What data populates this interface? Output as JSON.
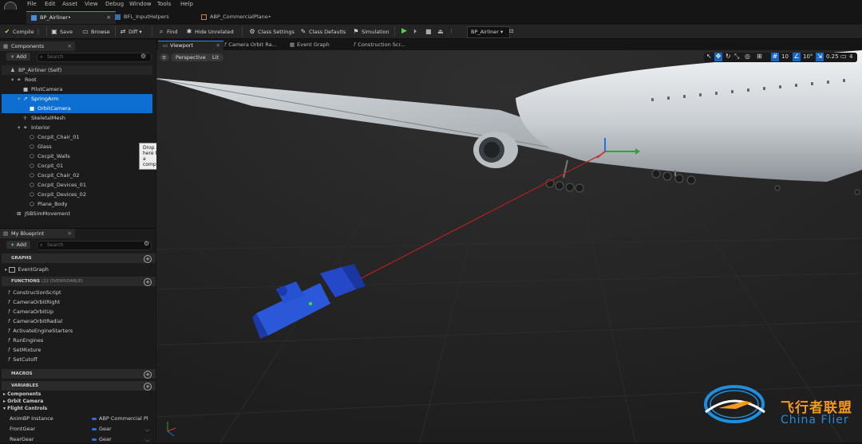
{
  "menu": [
    "File",
    "Edit",
    "Asset",
    "View",
    "Debug",
    "Window",
    "Tools",
    "Help"
  ],
  "tabs": [
    {
      "label": "BP_Airliner•",
      "active": true
    },
    {
      "label": "BFL_InputHelpers",
      "active": false
    },
    {
      "label": "ABP_CommercialPlane•",
      "active": false
    }
  ],
  "toolbar": {
    "compile": "Compile",
    "save": "Save",
    "browse": "Browse",
    "diff": "Diff",
    "find": "Find",
    "hide_unrelated": "Hide Unrelated",
    "class_settings": "Class Settings",
    "class_defaults": "Class Defaults",
    "simulation": "Simulation",
    "debug_object": "BP_Airliner"
  },
  "components": {
    "tab_label": "Components",
    "add_label": "Add",
    "search_placeholder": "Search",
    "tree": [
      {
        "label": "BP_Airliner (Self)",
        "indent": 0,
        "icon": "person-icon",
        "selected": false
      },
      {
        "label": "Root",
        "indent": 1,
        "icon": "root-icon",
        "selected": false
      },
      {
        "label": "PilotCamera",
        "indent": 2,
        "icon": "camera-icon",
        "selected": false
      },
      {
        "label": "SpringArm",
        "indent": 2,
        "icon": "springarm-icon",
        "selected": true
      },
      {
        "label": "OrbitCamera",
        "indent": 3,
        "icon": "camera-icon",
        "selected": true
      },
      {
        "label": "SkeletalMesh",
        "indent": 2,
        "icon": "skeleton-icon",
        "selected": false
      },
      {
        "label": "Interior",
        "indent": 2,
        "icon": "root-icon",
        "selected": false
      },
      {
        "label": "Cocpit_Chair_01",
        "indent": 3,
        "icon": "mesh-icon",
        "selected": false
      },
      {
        "label": "Glass",
        "indent": 3,
        "icon": "mesh-icon",
        "selected": false
      },
      {
        "label": "Cocpit_Walls",
        "indent": 3,
        "icon": "mesh-icon",
        "selected": false
      },
      {
        "label": "Cocpit_01",
        "indent": 3,
        "icon": "mesh-icon",
        "selected": false
      },
      {
        "label": "Cocpit_Chair_02",
        "indent": 3,
        "icon": "mesh-icon",
        "selected": false
      },
      {
        "label": "Cocpit_Devices_01",
        "indent": 3,
        "icon": "mesh-icon",
        "selected": false
      },
      {
        "label": "Cocpit_Devices_02",
        "indent": 3,
        "icon": "mesh-icon",
        "selected": false
      },
      {
        "label": "Plane_Body",
        "indent": 3,
        "icon": "mesh-icon",
        "selected": false
      },
      {
        "label": "JSBSimMovement",
        "indent": 1,
        "icon": "movement-icon",
        "selected": false
      }
    ],
    "tooltip": "Drop asset here to add a component."
  },
  "blueprint": {
    "tab_label": "My Blueprint",
    "add_label": "Add",
    "search_placeholder": "Search",
    "graphs_header": "GRAPHS",
    "event_graph": "EventGraph",
    "functions_header": "FUNCTIONS",
    "functions_count": "(22 OVERRIDABLE)",
    "functions": [
      "ConstructionScript",
      "CameraOrbitRight",
      "CameraOrbitUp",
      "CameraOrbitRadial",
      "ActivateEngineStarters",
      "RunEngines",
      "SetMixture",
      "SetCutoff"
    ],
    "macros_header": "MACROS",
    "variables_header": "VARIABLES",
    "variable_groups": [
      "Components",
      "Orbit Camera",
      "Flight Controls"
    ],
    "variables": [
      {
        "name": "AnimBP Instance",
        "type": "ABP Commercial Pl",
        "color": "#2f6fe0"
      },
      {
        "name": "FrontGear",
        "type": "Gear",
        "color": "#2f6fe0"
      },
      {
        "name": "RearGear",
        "type": "Gear",
        "color": "#2f6fe0"
      }
    ]
  },
  "viewport": {
    "tabs": [
      {
        "label": "Viewport",
        "active": true
      },
      {
        "label": "Camera Orbit Ra...",
        "active": false
      },
      {
        "label": "Event Graph",
        "active": false
      },
      {
        "label": "Construction Scr...",
        "active": false
      }
    ],
    "perspective": "Perspective",
    "lit": "Lit",
    "grid_snap": "10",
    "rot_snap": "10°",
    "scale_snap": "0.25",
    "camera_speed": "4"
  },
  "watermark": {
    "cn": "飞行者联盟",
    "en": "China Flier"
  }
}
